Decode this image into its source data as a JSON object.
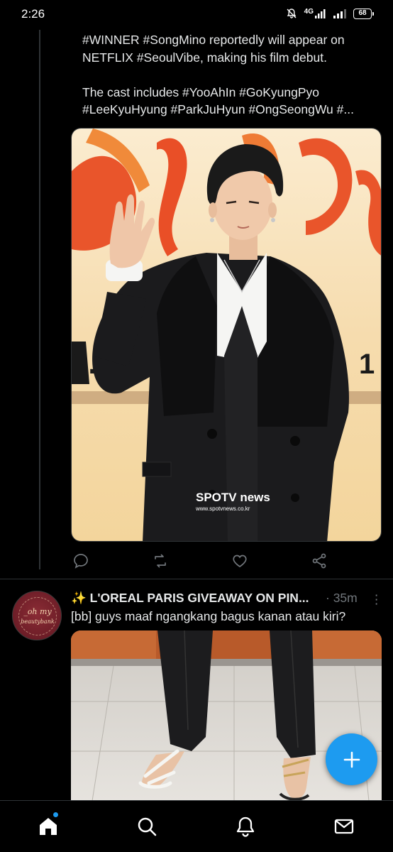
{
  "status_bar": {
    "time": "2:26",
    "network": "4G",
    "battery": "68"
  },
  "tweet1": {
    "text": "#WINNER #SongMino reportedly will appear on NETFLIX #SeoulVibe, making his film debut.\n\nThe cast includes #YooAhIn #GoKyungPyo #LeeKyuHyung #ParkJuHyun #OngSeongWu #...",
    "media": {
      "watermark_brand": "SPOTV news",
      "watermark_url": "www.spotvnews.co.kr"
    }
  },
  "tweet2": {
    "emoji": "✨",
    "name": "L'OREAL PARIS GIVEAWAY ON PIN...",
    "time": "· 35m",
    "more": "⋮",
    "text": "[bb] guys maaf ngangkang bagus kanan atau kiri?",
    "avatar": {
      "line1": "_oh my",
      "line2": "beautybank"
    }
  },
  "colors": {
    "background": "#000000",
    "text": "#e7e9ea",
    "muted": "#71767b",
    "accent": "#1d9bf0",
    "divider": "#2f3336"
  },
  "icons": {
    "action_bar": [
      "reply-icon",
      "retweet-icon",
      "like-icon",
      "share-icon"
    ],
    "bottom_nav": [
      "home-icon",
      "search-icon",
      "notifications-icon",
      "messages-icon"
    ],
    "fab": "compose-plus-icon"
  }
}
